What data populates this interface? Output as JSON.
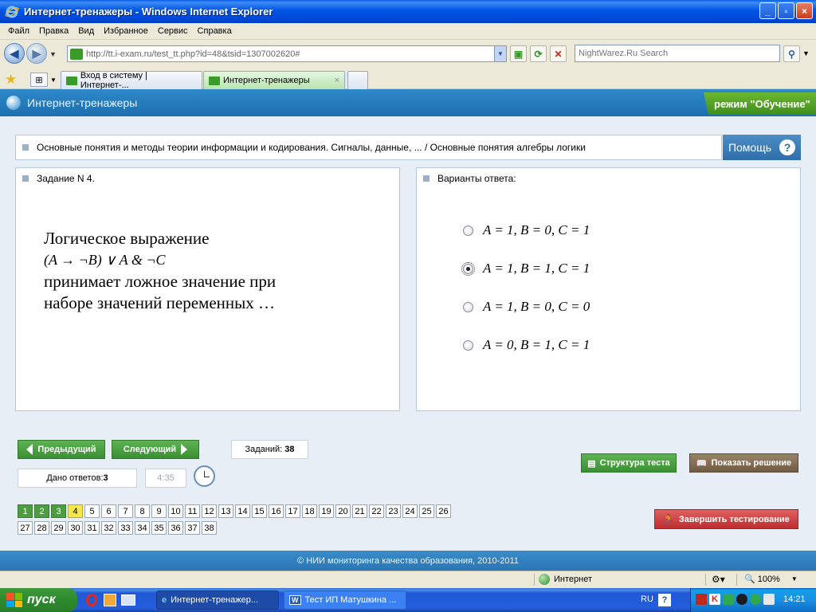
{
  "window": {
    "title": "Интернет-тренажеры - Windows Internet Explorer"
  },
  "menu": [
    "Файл",
    "Правка",
    "Вид",
    "Избранное",
    "Сервис",
    "Справка"
  ],
  "address": {
    "url": "http://tt.i-exam.ru/test_tt.php?id=48&tsid=1307002620#"
  },
  "search": {
    "placeholder": "NightWarez.Ru Search"
  },
  "tabs": [
    {
      "label": "Вход в систему | Интернет-..."
    },
    {
      "label": "Интернет-тренажеры"
    }
  ],
  "app": {
    "name": "Интернет-тренажеры",
    "mode": "режим \"Обучение\""
  },
  "topic": "Основные понятия и методы теории информации и кодирования. Сигналы, данные, ... / Основные понятия алгебры логики",
  "help_label": "Помощь",
  "question_panel": {
    "header": "Задание N 4.",
    "line1": "Логическое выражение",
    "formula": "(A → ¬B) ∨ A & ¬C",
    "line2": "принимает ложное значение при",
    "line3": "наборе значений переменных …"
  },
  "answers_panel": {
    "header": "Варианты ответа:",
    "options": [
      {
        "label": "A = 1,  B = 0,  C = 1",
        "selected": false
      },
      {
        "label": "A = 1,  B = 1,  C = 1",
        "selected": true
      },
      {
        "label": "A = 1,  B = 0,  C = 0",
        "selected": false
      },
      {
        "label": "A = 0,  B = 1,  C = 1",
        "selected": false
      }
    ]
  },
  "controls": {
    "prev": "Предыдущий",
    "next": "Следующий",
    "tasks_label": "Заданий:",
    "tasks_count": "38",
    "answers_label": "Дано ответов:",
    "answers_count": "3",
    "timer": "4:35",
    "structure": "Структура теста",
    "show_solution": "Показать решение",
    "finish": "Завершить тестирование"
  },
  "question_numbers": {
    "total": 38,
    "answered": [
      1,
      2,
      3
    ],
    "current": 4
  },
  "footer": "© НИИ мониторинга качества образования, 2010-2011",
  "status": {
    "zone": "Интернет",
    "zoom": "100%"
  },
  "taskbar": {
    "start": "пуск",
    "items": [
      {
        "label": "Интернет-тренажер...",
        "active": true
      },
      {
        "label": "Тест ИП Матушкина ...",
        "active": false
      }
    ],
    "lang": "RU",
    "time": "14:21"
  }
}
